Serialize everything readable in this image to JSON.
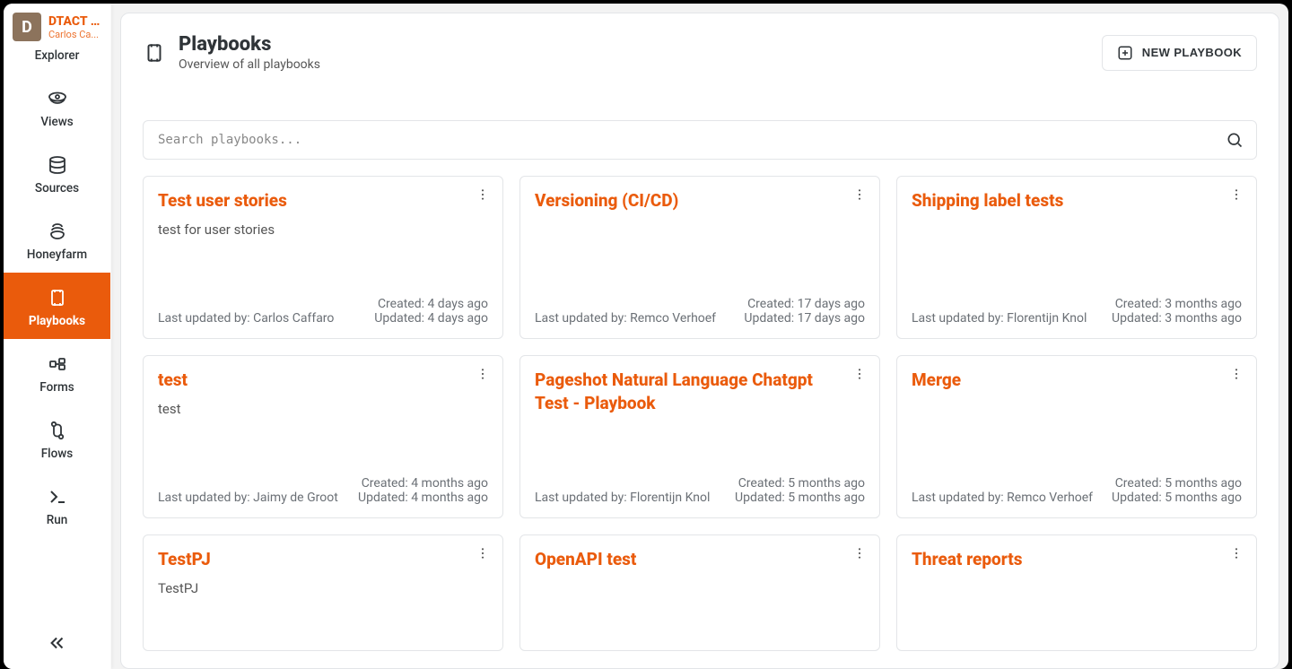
{
  "org": {
    "logo_letter": "D",
    "name": "DTACT ...",
    "subtitle": "Carlos Ca..."
  },
  "sidebar": [
    {
      "id": "explorer",
      "label": "Explorer"
    },
    {
      "id": "views",
      "label": "Views"
    },
    {
      "id": "sources",
      "label": "Sources"
    },
    {
      "id": "honeyfarm",
      "label": "Honeyfarm"
    },
    {
      "id": "playbooks",
      "label": "Playbooks",
      "active": true
    },
    {
      "id": "forms",
      "label": "Forms"
    },
    {
      "id": "flows",
      "label": "Flows"
    },
    {
      "id": "run",
      "label": "Run"
    }
  ],
  "header": {
    "title": "Playbooks",
    "subtitle": "Overview of all playbooks",
    "new_button": "NEW PLAYBOOK"
  },
  "search": {
    "placeholder": "Search playbooks..."
  },
  "cards": [
    {
      "title": "Test user stories",
      "desc": "test for user stories",
      "updated_by": "Last updated by: Carlos Caffaro",
      "created": "Created: 4 days ago",
      "updated": "Updated: 4 days ago"
    },
    {
      "title": "Versioning (CI/CD)",
      "desc": "",
      "updated_by": "Last updated by: Remco Verhoef",
      "created": "Created: 17 days ago",
      "updated": "Updated: 17 days ago"
    },
    {
      "title": "Shipping label tests",
      "desc": "",
      "updated_by": "Last updated by: Florentijn Knol",
      "created": "Created: 3 months ago",
      "updated": "Updated: 3 months ago"
    },
    {
      "title": "test",
      "desc": "test",
      "updated_by": "Last updated by: Jaimy de Groot",
      "created": "Created: 4 months ago",
      "updated": "Updated: 4 months ago"
    },
    {
      "title": "Pageshot Natural Language Chatgpt Test - Playbook",
      "desc": "",
      "updated_by": "Last updated by: Florentijn Knol",
      "created": "Created: 5 months ago",
      "updated": "Updated: 5 months ago"
    },
    {
      "title": "Merge",
      "desc": "",
      "updated_by": "Last updated by: Remco Verhoef",
      "created": "Created: 5 months ago",
      "updated": "Updated: 5 months ago"
    },
    {
      "title": "TestPJ",
      "desc": "TestPJ",
      "updated_by": "",
      "created": "",
      "updated": ""
    },
    {
      "title": "OpenAPI test",
      "desc": "",
      "updated_by": "",
      "created": "",
      "updated": ""
    },
    {
      "title": "Threat reports",
      "desc": "",
      "updated_by": "",
      "created": "",
      "updated": ""
    }
  ]
}
